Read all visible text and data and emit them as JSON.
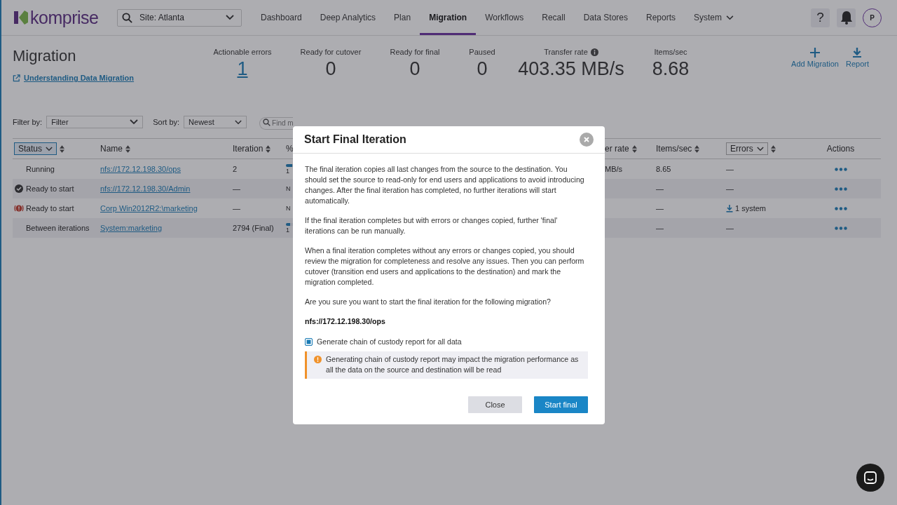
{
  "nav": {
    "logo": "komprise",
    "site_select": "Site: Atlanta",
    "tabs": [
      {
        "label": "Dashboard",
        "selected": false,
        "kind": "link"
      },
      {
        "label": "Deep Analytics",
        "selected": false,
        "kind": "link"
      },
      {
        "label": "Plan",
        "selected": false,
        "kind": "link"
      },
      {
        "label": "Migration",
        "selected": true,
        "kind": "link"
      },
      {
        "label": "Workflows",
        "selected": false,
        "kind": "link"
      },
      {
        "label": "Recall",
        "selected": false,
        "kind": "link"
      },
      {
        "label": "Data Stores",
        "selected": false,
        "kind": "link"
      },
      {
        "label": "Reports",
        "selected": false,
        "kind": "link"
      },
      {
        "label": "System",
        "selected": false,
        "kind": "dropdown"
      }
    ],
    "help": "?",
    "avatar": "P"
  },
  "page": {
    "title": "Migration",
    "guide_link": "Understanding Data Migration",
    "stats": [
      {
        "label": "Actionable errors",
        "value": "1",
        "kind": "link",
        "info": false
      },
      {
        "label": "Ready for cutover",
        "value": "0",
        "kind": "plain",
        "info": false
      },
      {
        "label": "Ready for final",
        "value": "0",
        "kind": "plain",
        "info": false
      },
      {
        "label": "Paused",
        "value": "0",
        "kind": "plain",
        "info": false
      },
      {
        "label": "Transfer rate",
        "value": "403.35 MB/s",
        "kind": "plain",
        "info": true
      },
      {
        "label": "Items/sec",
        "value": "8.68",
        "kind": "plain",
        "info": false
      }
    ],
    "actions": [
      {
        "label": "Add Migration",
        "kind": "add"
      },
      {
        "label": "Report",
        "kind": "download"
      }
    ]
  },
  "filters": {
    "filter_label": "Filter by:",
    "filter_value": "Filter",
    "sort_label": "Sort by:",
    "sort_value": "Newest",
    "search_placeholder": "Find m"
  },
  "table": {
    "columns": [
      {
        "label": "Status",
        "kind": "filter",
        "sortable": true
      },
      {
        "label": "Name",
        "kind": "plain",
        "sortable": true
      },
      {
        "label": "Iteration",
        "kind": "plain",
        "sortable": true
      },
      {
        "label": "%",
        "kind": "plain",
        "sortable": false
      },
      {
        "label": "er rate",
        "kind": "plain",
        "sortable": true
      },
      {
        "label": "Items/sec",
        "kind": "plain",
        "sortable": true
      },
      {
        "label": "Errors",
        "kind": "filter",
        "sortable": true
      },
      {
        "label": "Actions",
        "kind": "plain",
        "sortable": false
      }
    ],
    "rows": [
      {
        "status": {
          "label": "Running",
          "kind": "none"
        },
        "name": "nfs://172.12.198.30/ops",
        "iteration": "2",
        "column_4": {
          "label": "1",
          "kind": "bar",
          "level": 0.15
        },
        "column_5": "MB/s",
        "items_sec": "8.65",
        "errors": {
          "label": "—",
          "kind": "plain"
        }
      },
      {
        "status": {
          "label": "Ready to start",
          "kind": "check"
        },
        "name": "nfs://172.12.198.30/Admin",
        "iteration": "—",
        "column_4": {
          "label": "N",
          "kind": "text"
        },
        "items_sec": "—",
        "errors": {
          "label": "—",
          "kind": "plain"
        }
      },
      {
        "status": {
          "label": "Ready to start",
          "kind": "error"
        },
        "name": "Corp Win2012R2:\\marketing",
        "iteration": "—",
        "column_4": {
          "label": "N",
          "kind": "text"
        },
        "items_sec": "—",
        "errors": {
          "label": "1 system",
          "kind": "download"
        }
      },
      {
        "status": {
          "label": "Between iterations",
          "kind": "none"
        },
        "name": "System:marketing",
        "iteration": "2794 (Final)",
        "column_4": {
          "label": "1",
          "kind": "bar",
          "level": 0.1
        },
        "items_sec": "—",
        "errors": {
          "label": "—",
          "kind": "plain"
        }
      }
    ]
  },
  "dialog": {
    "title": "Start Final Iteration",
    "paragraphs": [
      "The final iteration copies all last changes from the source to the destination. You should set the source to read-only for end users and applications to avoid introducing changes. After the final iteration has completed, no further iterations will start automatically.",
      "If the final iteration completes but with errors or changes copied, further 'final' iterations can be run manually.",
      "When a final iteration completes without any errors or changes copied, you should review the migration for completeness and resolve any issues. Then you can perform cutover (transition end users and applications to the destination) and mark the migration completed.",
      "Are you sure you want to start the final iteration for the following migration?"
    ],
    "migration": "nfs://172.12.198.30/ops",
    "checkbox": {
      "label": "Generate chain of custody report for all data",
      "checked": true
    },
    "warning": "Generating chain of custody report may impact the migration performance as all the data on the source and destination will be read",
    "buttons": [
      {
        "label": "Close",
        "kind": "secondary"
      },
      {
        "label": "Start final",
        "kind": "primary"
      }
    ]
  }
}
